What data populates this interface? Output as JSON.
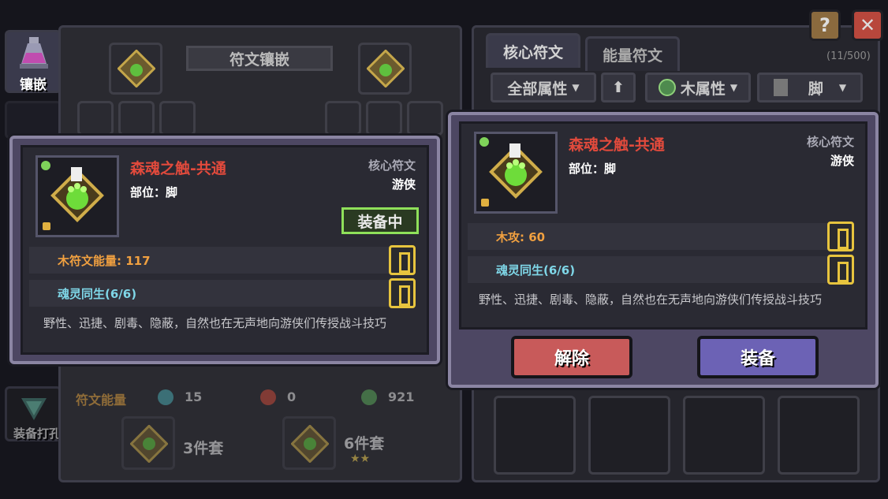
{
  "sidebar": {
    "inlay_label": "镶嵌",
    "punch_label": "装备打孔"
  },
  "inlay_panel": {
    "title": "符文镶嵌",
    "energy_label": "符文能量",
    "energy_values": [
      "15",
      "0",
      "921"
    ],
    "set3_label": "3件套",
    "set6_label": "6件套",
    "set6_stars": "★★"
  },
  "rune_list": {
    "tabs": [
      "核心符文",
      "能量符文"
    ],
    "count": "(11/500)",
    "filters": {
      "attr_all": "全部属性",
      "wood_attr": "木属性",
      "part": "脚"
    }
  },
  "top_buttons": {
    "help": "?",
    "close": "✕"
  },
  "equipped_popup": {
    "name": "森魂之触-共通",
    "part_label": "部位：脚",
    "type": "核心符文",
    "class": "游侠",
    "equipped_badge": "装备中",
    "stats": [
      "木符文能量: 117",
      "魂灵同生(6/6)"
    ],
    "description": "野性、迅捷、剧毒、隐蔽，自然也在无声地向游侠们传授战斗技巧"
  },
  "selected_popup": {
    "name": "森魂之触-共通",
    "part_label": "部位：脚",
    "type": "核心符文",
    "class": "游侠",
    "stats": [
      "木攻: 60",
      "魂灵同生(6/6)"
    ],
    "description": "野性、迅捷、剧毒、隐蔽，自然也在无声地向游侠们传授战斗技巧",
    "remove_label": "解除",
    "equip_label": "装备"
  },
  "colors": {
    "rune_name": "#e24a3c",
    "stat_orange": "#f0a040",
    "stat_cyan": "#7fd7e8",
    "equipped_green": "#8fe05a",
    "remove_red": "#c85a5a",
    "equip_purple": "#6c62b5"
  }
}
